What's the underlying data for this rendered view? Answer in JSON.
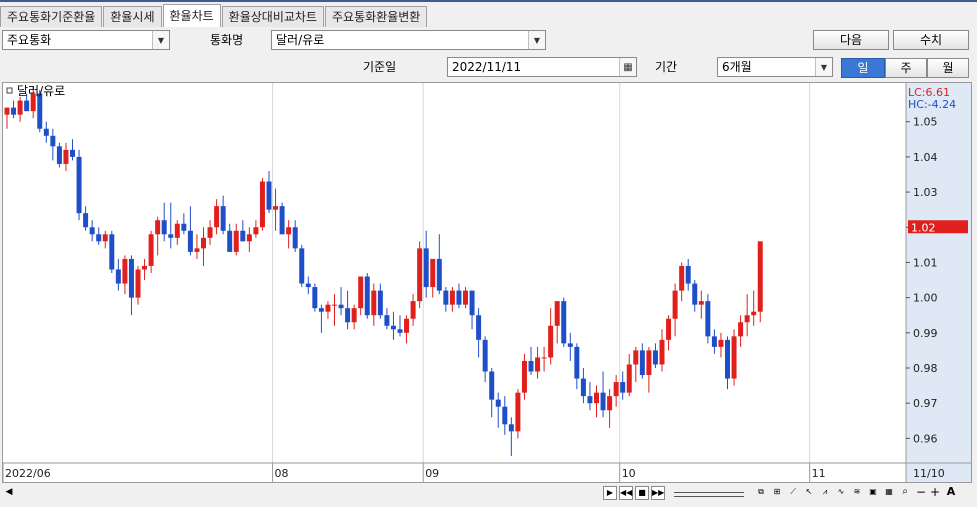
{
  "tabs": [
    {
      "label": "주요통화기준환율"
    },
    {
      "label": "환율시세"
    },
    {
      "label": "환율차트"
    },
    {
      "label": "환율상대비교차트"
    },
    {
      "label": "주요통화환율변환"
    }
  ],
  "active_tab": 2,
  "filters": {
    "currency_group": "주요통화",
    "currency_label": "통화명",
    "currency_value": "달러/유로",
    "next_button": "다음",
    "values_button": "수치",
    "date_label": "기준일",
    "date_value": "2022/11/11",
    "period_label": "기간",
    "period_value": "6개월",
    "interval_day": "일",
    "interval_week": "주",
    "interval_month": "월",
    "active_interval": "일"
  },
  "colors": {
    "up": "#e0201c",
    "down": "#1f4fc8",
    "accent": "#3a78d6"
  },
  "chart_data": {
    "type": "candlestick",
    "title": "달러/유로",
    "legend": {
      "lc": "LC:6.61",
      "hc": "HC:-4.24"
    },
    "ylim": [
      0.953,
      1.061
    ],
    "yticks": [
      "1.05",
      "1.04",
      "1.03",
      "1.02",
      "1.01",
      "1.00",
      "0.99",
      "0.98",
      "0.97",
      "0.96"
    ],
    "ytick_values": [
      1.05,
      1.04,
      1.03,
      1.02,
      1.01,
      1.0,
      0.99,
      0.98,
      0.97,
      0.96
    ],
    "x_labels": [
      {
        "label": "2022/06",
        "index": 0
      },
      {
        "label": "08",
        "index": 41
      },
      {
        "label": "09",
        "index": 64
      },
      {
        "label": "10",
        "index": 94
      },
      {
        "label": "11",
        "index": 123
      }
    ],
    "x_end_label": "11/10",
    "last_price": "1.02",
    "candles": [
      [
        1.052,
        1.054,
        1.048,
        1.054
      ],
      [
        1.054,
        1.056,
        1.051,
        1.052
      ],
      [
        1.052,
        1.057,
        1.05,
        1.056
      ],
      [
        1.056,
        1.058,
        1.053,
        1.053
      ],
      [
        1.053,
        1.06,
        1.051,
        1.058
      ],
      [
        1.058,
        1.059,
        1.047,
        1.048
      ],
      [
        1.048,
        1.05,
        1.044,
        1.046
      ],
      [
        1.046,
        1.048,
        1.039,
        1.043
      ],
      [
        1.043,
        1.044,
        1.037,
        1.038
      ],
      [
        1.038,
        1.044,
        1.036,
        1.042
      ],
      [
        1.042,
        1.045,
        1.039,
        1.04
      ],
      [
        1.04,
        1.042,
        1.022,
        1.024
      ],
      [
        1.024,
        1.026,
        1.019,
        1.02
      ],
      [
        1.02,
        1.022,
        1.016,
        1.018
      ],
      [
        1.018,
        1.02,
        1.015,
        1.016
      ],
      [
        1.016,
        1.019,
        1.014,
        1.018
      ],
      [
        1.018,
        1.019,
        1.007,
        1.008
      ],
      [
        1.008,
        1.011,
        1.002,
        1.004
      ],
      [
        1.004,
        1.012,
        1.001,
        1.011
      ],
      [
        1.011,
        1.012,
        0.995,
        1.0
      ],
      [
        1.0,
        1.009,
        0.998,
        1.008
      ],
      [
        1.008,
        1.011,
        1.005,
        1.009
      ],
      [
        1.009,
        1.019,
        1.007,
        1.018
      ],
      [
        1.018,
        1.023,
        1.012,
        1.022
      ],
      [
        1.022,
        1.027,
        1.016,
        1.018
      ],
      [
        1.018,
        1.027,
        1.014,
        1.017
      ],
      [
        1.017,
        1.022,
        1.015,
        1.021
      ],
      [
        1.021,
        1.024,
        1.018,
        1.019
      ],
      [
        1.019,
        1.026,
        1.012,
        1.013
      ],
      [
        1.013,
        1.018,
        1.011,
        1.014
      ],
      [
        1.014,
        1.02,
        1.009,
        1.017
      ],
      [
        1.017,
        1.022,
        1.015,
        1.02
      ],
      [
        1.02,
        1.028,
        1.018,
        1.026
      ],
      [
        1.026,
        1.029,
        1.018,
        1.019
      ],
      [
        1.019,
        1.021,
        1.013,
        1.013
      ],
      [
        1.013,
        1.021,
        1.012,
        1.019
      ],
      [
        1.019,
        1.022,
        1.016,
        1.016
      ],
      [
        1.016,
        1.02,
        1.013,
        1.018
      ],
      [
        1.018,
        1.022,
        1.017,
        1.02
      ],
      [
        1.02,
        1.034,
        1.019,
        1.033
      ],
      [
        1.033,
        1.036,
        1.024,
        1.025
      ],
      [
        1.025,
        1.031,
        1.019,
        1.026
      ],
      [
        1.026,
        1.027,
        1.018,
        1.018
      ],
      [
        1.018,
        1.022,
        1.014,
        1.02
      ],
      [
        1.02,
        1.022,
        1.013,
        1.014
      ],
      [
        1.014,
        1.015,
        1.003,
        1.004
      ],
      [
        1.004,
        1.006,
        1.001,
        1.003
      ],
      [
        1.003,
        1.004,
        0.996,
        0.997
      ],
      [
        0.997,
        0.998,
        0.99,
        0.996
      ],
      [
        0.996,
        0.999,
        0.994,
        0.998
      ],
      [
        0.998,
        1.001,
        0.992,
        0.998
      ],
      [
        0.998,
        1.003,
        0.995,
        0.997
      ],
      [
        0.997,
        1.002,
        0.991,
        0.993
      ],
      [
        0.993,
        0.998,
        0.991,
        0.997
      ],
      [
        0.997,
        1.004,
        0.995,
        1.006
      ],
      [
        1.006,
        1.007,
        0.994,
        0.995
      ],
      [
        0.995,
        1.004,
        0.992,
        1.002
      ],
      [
        1.002,
        1.004,
        0.994,
        0.995
      ],
      [
        0.995,
        0.997,
        0.991,
        0.992
      ],
      [
        0.992,
        0.996,
        0.988,
        0.991
      ],
      [
        0.991,
        0.995,
        0.989,
        0.99
      ],
      [
        0.99,
        0.995,
        0.987,
        0.994
      ],
      [
        0.994,
        1.001,
        0.992,
        0.999
      ],
      [
        0.999,
        1.016,
        0.997,
        1.014
      ],
      [
        1.014,
        1.019,
        1.0,
        1.003
      ],
      [
        1.003,
        1.009,
        1.0,
        1.011
      ],
      [
        1.011,
        1.018,
        1.001,
        1.002
      ],
      [
        1.002,
        1.003,
        0.996,
        0.998
      ],
      [
        0.998,
        1.003,
        0.996,
        1.002
      ],
      [
        1.002,
        1.004,
        0.997,
        0.998
      ],
      [
        0.998,
        1.003,
        0.997,
        1.002
      ],
      [
        1.002,
        1.002,
        0.991,
        0.995
      ],
      [
        0.995,
        0.997,
        0.983,
        0.988
      ],
      [
        0.988,
        0.989,
        0.976,
        0.979
      ],
      [
        0.979,
        0.98,
        0.966,
        0.971
      ],
      [
        0.971,
        0.973,
        0.963,
        0.969
      ],
      [
        0.969,
        0.972,
        0.961,
        0.964
      ],
      [
        0.964,
        0.966,
        0.955,
        0.962
      ],
      [
        0.962,
        0.974,
        0.96,
        0.973
      ],
      [
        0.973,
        0.984,
        0.971,
        0.982
      ],
      [
        0.982,
        0.986,
        0.978,
        0.979
      ],
      [
        0.979,
        0.986,
        0.977,
        0.983
      ],
      [
        0.983,
        0.986,
        0.979,
        0.983
      ],
      [
        0.983,
        0.997,
        0.981,
        0.992
      ],
      [
        0.992,
        0.999,
        0.987,
        0.999
      ],
      [
        0.999,
        1.0,
        0.986,
        0.987
      ],
      [
        0.987,
        0.99,
        0.982,
        0.986
      ],
      [
        0.986,
        0.987,
        0.974,
        0.977
      ],
      [
        0.977,
        0.98,
        0.97,
        0.972
      ],
      [
        0.972,
        0.976,
        0.968,
        0.97
      ],
      [
        0.97,
        0.975,
        0.966,
        0.973
      ],
      [
        0.973,
        0.979,
        0.966,
        0.968
      ],
      [
        0.968,
        0.974,
        0.963,
        0.972
      ],
      [
        0.972,
        0.978,
        0.969,
        0.976
      ],
      [
        0.976,
        0.979,
        0.971,
        0.973
      ],
      [
        0.973,
        0.984,
        0.972,
        0.981
      ],
      [
        0.981,
        0.986,
        0.976,
        0.985
      ],
      [
        0.985,
        0.987,
        0.977,
        0.978
      ],
      [
        0.978,
        0.986,
        0.973,
        0.985
      ],
      [
        0.985,
        0.987,
        0.98,
        0.981
      ],
      [
        0.981,
        0.991,
        0.979,
        0.988
      ],
      [
        0.988,
        0.995,
        0.985,
        0.994
      ],
      [
        0.994,
        1.004,
        0.989,
        1.002
      ],
      [
        1.002,
        1.01,
        0.999,
        1.009
      ],
      [
        1.009,
        1.011,
        1.002,
        1.004
      ],
      [
        1.004,
        1.005,
        0.996,
        0.998
      ],
      [
        0.998,
        1.002,
        0.994,
        0.999
      ],
      [
        0.999,
        1.001,
        0.987,
        0.989
      ],
      [
        0.989,
        0.991,
        0.984,
        0.986
      ],
      [
        0.986,
        0.99,
        0.983,
        0.988
      ],
      [
        0.988,
        0.989,
        0.974,
        0.977
      ],
      [
        0.977,
        0.991,
        0.975,
        0.989
      ],
      [
        0.989,
        0.995,
        0.986,
        0.993
      ],
      [
        0.993,
        1.001,
        0.989,
        0.995
      ],
      [
        0.995,
        1.002,
        0.992,
        0.996
      ],
      [
        0.996,
        1.01,
        0.993,
        1.016
      ]
    ]
  }
}
